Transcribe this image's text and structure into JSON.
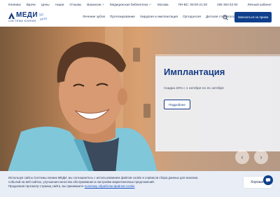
{
  "topbar": {
    "links": [
      "Клиника",
      "Врачи",
      "Цены",
      "Акции",
      "Отзывы",
      "Вакансии",
      "Медицинская библиотека"
    ],
    "city": "Москва",
    "hours": "ПН-ВС: 08:00-21:30",
    "phone": "495 363 63 93",
    "account": "Личный кабинет"
  },
  "header": {
    "logo_word": "МЕДИ",
    "logo_sub": "СИСТЕМА КЛИНИК",
    "logo_script": "30 лет",
    "nav": [
      "Лечение зубов",
      "Протезирование",
      "Хирургия и имплантация",
      "Ортодонтия",
      "Детская стоматология",
      "Другие услуги"
    ],
    "cta": "Записаться на прием"
  },
  "hero": {
    "title": "Имплантация",
    "desc": "Скидка 20% с 1 октября по 31 октября",
    "more": "Подробнее",
    "prev": "‹",
    "next": "›"
  },
  "cookie": {
    "line1": "Используя сайты Системы клиник МЕДИ, вы соглашаетесь с использованием файлов cookie и сервисов сбора данных для анализа",
    "line2": "событий на веб-сайтах, улучшения качества обслуживания и настройки маркетинговых предложений.",
    "line3": "Продолжая просмотр страниц сайта, вы принимаете",
    "link": "политику обработки файлов cookie",
    "ok": "Хорошо"
  },
  "colors": {
    "brand": "#0f3f8c",
    "title": "#143b86",
    "cookie_bg": "#e8edf6"
  },
  "icons": [
    "external-link-icon",
    "search-icon",
    "chevron-left-icon",
    "chevron-right-icon",
    "chat-icon"
  ]
}
